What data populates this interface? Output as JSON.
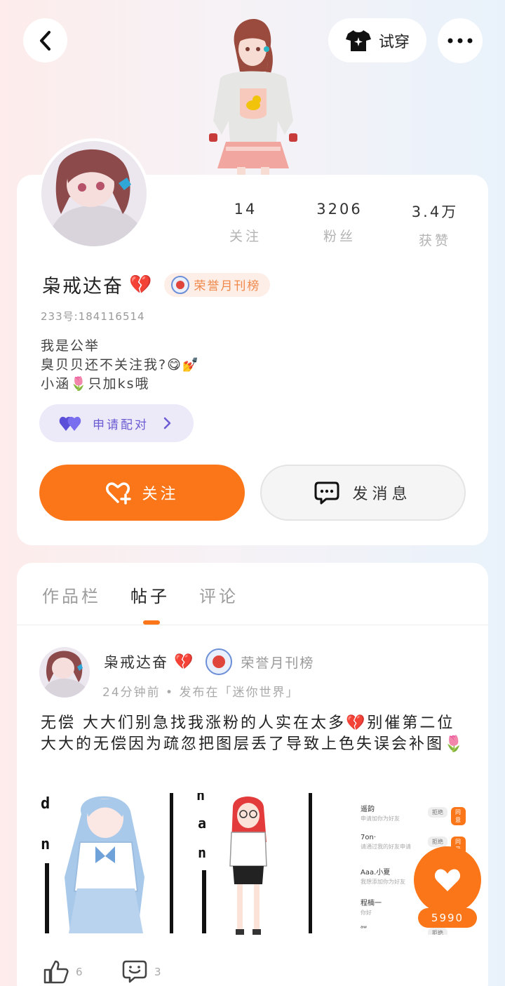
{
  "header": {
    "tryon_label": "试穿",
    "back_icon": "chevron-left-icon",
    "more_icon": "more-dots-icon",
    "tryon_icon": "tshirt-sparkle-icon"
  },
  "profile": {
    "name": "枭戒达奋",
    "name_emoji": "💔",
    "badge_label": "荣誉月刊榜",
    "id_line": "233号:184116514",
    "bio_lines": [
      "我是公举",
      "臭贝贝还不关注我?😋💅",
      "小涵🌷只加ks哦"
    ],
    "stats": [
      {
        "value": "14",
        "label": "关注"
      },
      {
        "value": "3206",
        "label": "粉丝"
      },
      {
        "value": "3.4万",
        "label": "获赞"
      }
    ],
    "pair_label": "申请配对",
    "follow_label": "关注",
    "message_label": "发消息"
  },
  "tabs": [
    {
      "label": "作品栏",
      "active": false
    },
    {
      "label": "帖子",
      "active": true
    },
    {
      "label": "评论",
      "active": false
    }
  ],
  "post": {
    "author": "枭戒达奋",
    "author_emoji": "💔",
    "badge_label": "荣誉月刊榜",
    "meta": "24分钟前 • 发布在「迷你世界」",
    "text": "无偿 大大们别急找我涨粉的人实在太多💔别催第二位大大的无偿因为疏忽把图层丢了导致上色失误会补图🌷",
    "likes": "6",
    "comments": "3",
    "image3_rows": [
      {
        "name": "遥韵",
        "sub": "申请加你为好友",
        "reject": "拒绝",
        "accept": "同意"
      },
      {
        "name": "7on·",
        "sub": "请通过我的好友申请",
        "reject": "拒绝",
        "accept": "同意"
      },
      {
        "name": "Aaa.小夏",
        "sub": "我想添加你为好友",
        "reject": "",
        "accept": ""
      },
      {
        "name": "程楠一",
        "sub": "你好",
        "reject": "",
        "accept": ""
      },
      {
        "name": "ᵃʷ",
        "sub": "",
        "reject": "拒绝",
        "accept": ""
      }
    ]
  },
  "fab": {
    "count": "5990",
    "icon": "heart-icon"
  },
  "colors": {
    "accent": "#fb7618",
    "badge_text": "#f0884a",
    "pair_text": "#6a5bd3"
  }
}
